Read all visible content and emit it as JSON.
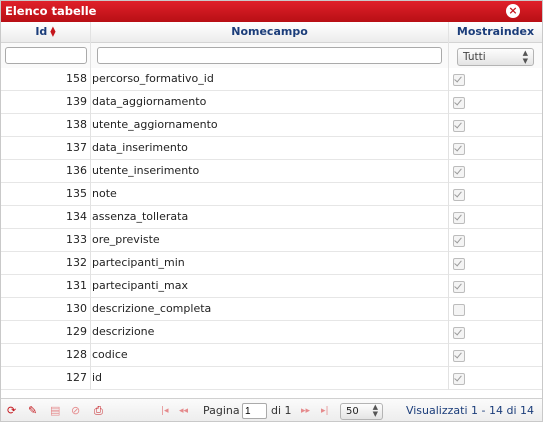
{
  "window": {
    "title": "Elenco tabelle"
  },
  "columns": {
    "id": "Id",
    "name": "Nomecampo",
    "index": "Mostraindex"
  },
  "filters": {
    "id_value": "",
    "name_value": "",
    "index_selected": "Tutti"
  },
  "rows": [
    {
      "id": "158",
      "name": "percorso_formativo_id",
      "checked": true
    },
    {
      "id": "139",
      "name": "data_aggiornamento",
      "checked": true
    },
    {
      "id": "138",
      "name": "utente_aggiornamento",
      "checked": true
    },
    {
      "id": "137",
      "name": "data_inserimento",
      "checked": true
    },
    {
      "id": "136",
      "name": "utente_inserimento",
      "checked": true
    },
    {
      "id": "135",
      "name": "note",
      "checked": true
    },
    {
      "id": "134",
      "name": "assenza_tollerata",
      "checked": true
    },
    {
      "id": "133",
      "name": "ore_previste",
      "checked": true
    },
    {
      "id": "132",
      "name": "partecipanti_min",
      "checked": true
    },
    {
      "id": "131",
      "name": "partecipanti_max",
      "checked": true
    },
    {
      "id": "130",
      "name": "descrizione_completa",
      "checked": false
    },
    {
      "id": "129",
      "name": "descrizione",
      "checked": true
    },
    {
      "id": "128",
      "name": "codice",
      "checked": true
    },
    {
      "id": "127",
      "name": "id",
      "checked": true
    }
  ],
  "footer": {
    "page_label": "Pagina",
    "page_value": "1",
    "of_label": "di 1",
    "rows_per_page": "50",
    "info": "Visualizzati 1 - 14 di 14"
  },
  "icons": {
    "refresh": "refresh-icon",
    "edit": "edit-icon",
    "save": "save-icon",
    "cancel": "cancel-icon",
    "print": "print-icon",
    "close": "close-icon"
  },
  "colors": {
    "accent": "#c4161c",
    "header_text": "#1b3d7a"
  }
}
